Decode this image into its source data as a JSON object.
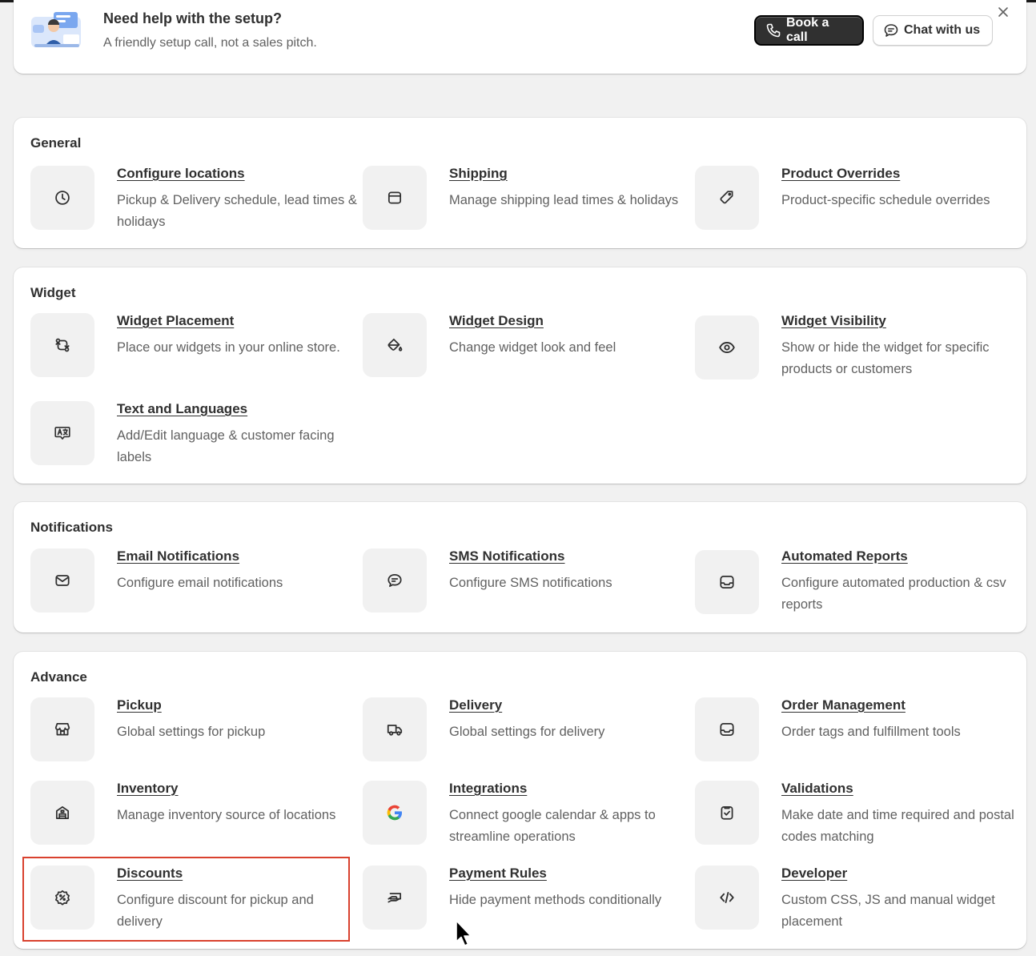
{
  "banner": {
    "title": "Need help with the setup?",
    "subtitle": "A friendly setup call, not a sales pitch.",
    "book_call_label": "Book a call",
    "chat_label": "Chat with us"
  },
  "sections": {
    "general": {
      "title": "General",
      "items": [
        {
          "title": "Configure locations",
          "desc": "Pickup & Delivery schedule, lead times & holidays",
          "icon": "clock-icon"
        },
        {
          "title": "Shipping",
          "desc": "Manage shipping lead times & holidays",
          "icon": "package-icon"
        },
        {
          "title": "Product Overrides",
          "desc": "Product-specific schedule overrides",
          "icon": "tag-icon"
        }
      ]
    },
    "widget": {
      "title": "Widget",
      "items": [
        {
          "title": "Widget Placement",
          "desc": "Place our widgets in your online store.",
          "icon": "arrows-swap-icon"
        },
        {
          "title": "Widget Design",
          "desc": "Change widget look and feel",
          "icon": "paint-bucket-icon"
        },
        {
          "title": "Widget Visibility",
          "desc": "Show or hide the widget for specific products or customers",
          "icon": "eye-icon"
        },
        {
          "title": "Text and Languages",
          "desc": "Add/Edit language & customer facing labels",
          "icon": "language-icon"
        }
      ]
    },
    "notifications": {
      "title": "Notifications",
      "items": [
        {
          "title": "Email Notifications",
          "desc": "Configure email notifications",
          "icon": "envelope-icon"
        },
        {
          "title": "SMS Notifications",
          "desc": "Configure SMS notifications",
          "icon": "chat-bubble-icon"
        },
        {
          "title": "Automated Reports",
          "desc": "Configure automated production & csv reports",
          "icon": "inbox-icon"
        }
      ]
    },
    "advance": {
      "title": "Advance",
      "items": [
        {
          "title": "Pickup",
          "desc": "Global settings for pickup",
          "icon": "store-icon"
        },
        {
          "title": "Delivery",
          "desc": "Global settings for delivery",
          "icon": "truck-icon"
        },
        {
          "title": "Order Management",
          "desc": "Order tags and fulfillment tools",
          "icon": "inbox-icon"
        },
        {
          "title": "Inventory",
          "desc": "Manage inventory source of locations",
          "icon": "warehouse-icon"
        },
        {
          "title": "Integrations",
          "desc": "Connect google calendar & apps to streamline operations",
          "icon": "google-icon"
        },
        {
          "title": "Validations",
          "desc": "Make date and time required and postal codes matching",
          "icon": "clipboard-check-icon"
        },
        {
          "title": "Discounts",
          "desc": "Configure discount for pickup and delivery",
          "icon": "discount-badge-icon"
        },
        {
          "title": "Payment Rules",
          "desc": "Hide payment methods conditionally",
          "icon": "cash-hand-icon"
        },
        {
          "title": "Developer",
          "desc": "Custom CSS, JS and manual widget placement",
          "icon": "code-icon"
        }
      ]
    }
  },
  "colors": {
    "background": "#f1f1f1",
    "card": "#ffffff",
    "text_primary": "#303030",
    "text_secondary": "#616161",
    "highlight_border": "#d9412e",
    "dark_button": "#303030"
  }
}
